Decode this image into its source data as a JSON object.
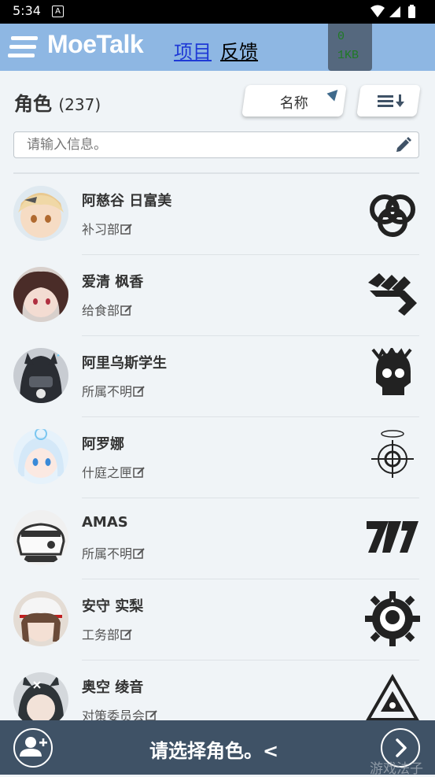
{
  "status_bar": {
    "time": "5:34",
    "notification": "A"
  },
  "header": {
    "brand": "MoeTalk",
    "nav_project": "项目",
    "nav_feedback": "反馈",
    "memory_line1": "0",
    "memory_line2": "1KB"
  },
  "character_panel": {
    "title": "角色",
    "count": "(237)",
    "sort_label": "名称",
    "search_placeholder": "请输入信息。"
  },
  "characters": [
    {
      "name": "阿慈谷 日富美",
      "club": "补习部"
    },
    {
      "name": "爱清 枫香",
      "club": "给食部"
    },
    {
      "name": "阿里乌斯学生",
      "club": "所属不明"
    },
    {
      "name": "阿罗娜",
      "club": "什庭之匣"
    },
    {
      "name": "AMAS",
      "club": "所属不明"
    },
    {
      "name": "安守 实梨",
      "club": "工务部"
    },
    {
      "name": "奥空 绫音",
      "club": "对策委员会"
    }
  ],
  "bottom_bar": {
    "message": "请选择角色。<"
  },
  "watermark": "游戏法子",
  "colors": {
    "header": "#8eb7e3",
    "bottom_bar": "#3f5266",
    "background": "#f0f4f7"
  }
}
